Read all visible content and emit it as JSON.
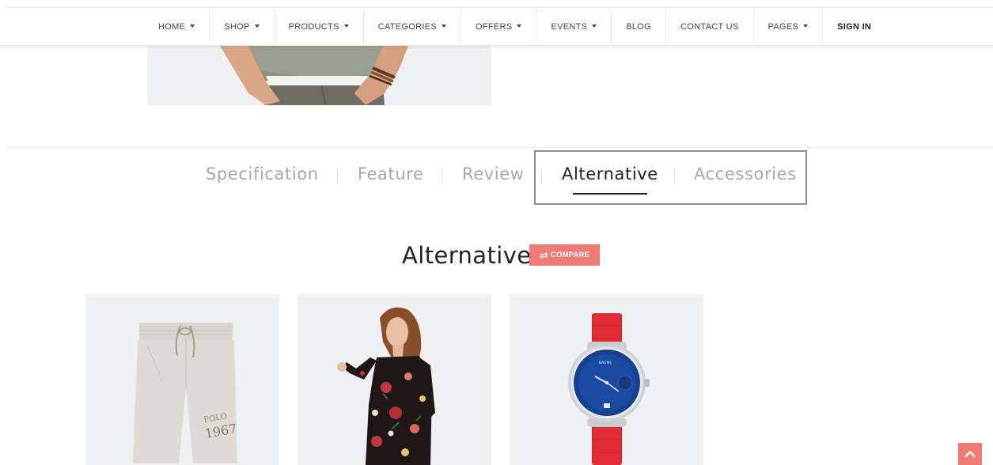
{
  "nav": {
    "items": [
      {
        "label": "HOME",
        "dropdown": true
      },
      {
        "label": "SHOP",
        "dropdown": true
      },
      {
        "label": "PRODUCTS",
        "dropdown": true
      },
      {
        "label": "CATEGORIES",
        "dropdown": true
      },
      {
        "label": "OFFERS",
        "dropdown": true
      },
      {
        "label": "EVENTS",
        "dropdown": true
      },
      {
        "label": "BLOG",
        "dropdown": false
      },
      {
        "label": "CONTACT US",
        "dropdown": false
      },
      {
        "label": "PAGES",
        "dropdown": true
      },
      {
        "label": "SIGN IN",
        "dropdown": false
      }
    ]
  },
  "tabs": {
    "items": [
      "Specification",
      "Feature",
      "Review",
      "Alternative",
      "Accessories"
    ],
    "active": "Alternative"
  },
  "section": {
    "title": "Alternative",
    "compare_label": "COMPARE",
    "compare_icon": "swap-arrows-icon"
  },
  "products": [
    {
      "image": "grey-shorts"
    },
    {
      "image": "floral-dress"
    },
    {
      "image": "red-strap-watch"
    }
  ],
  "colors": {
    "accent": "#f07a76",
    "card_bg": "#eef0f2",
    "tab_inactive": "#a8a8a8",
    "tab_active": "#222222"
  },
  "back_to_top_icon": "chevron-up-icon"
}
